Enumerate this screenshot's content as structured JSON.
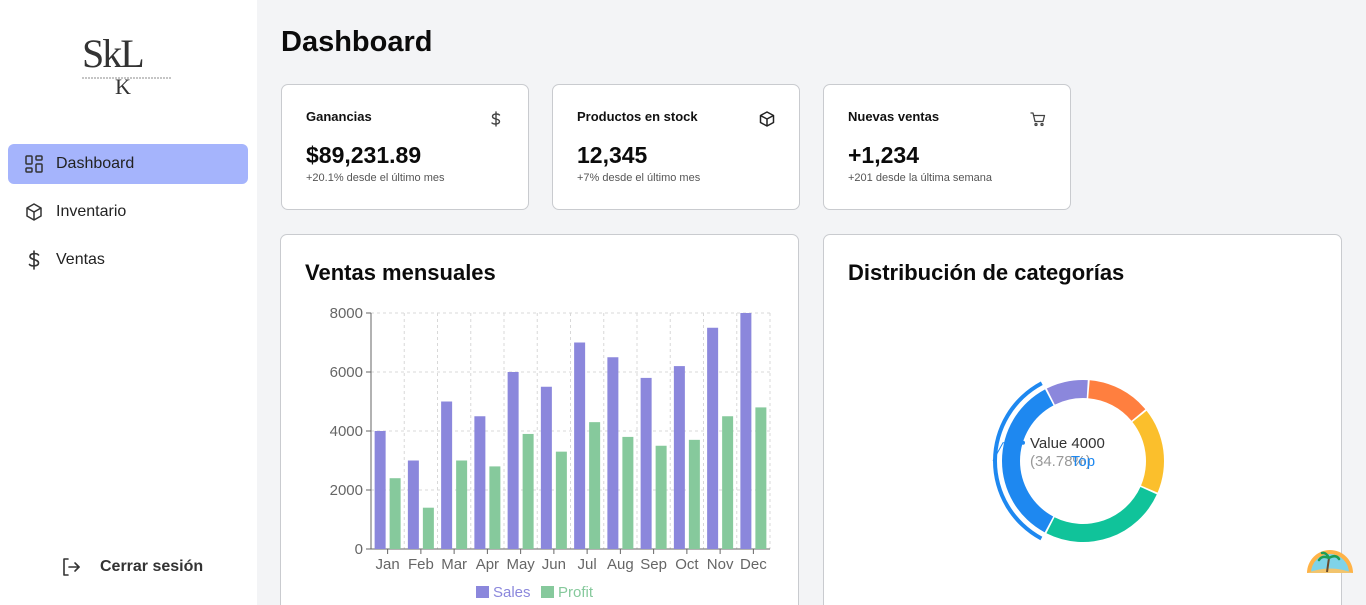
{
  "sidebar": {
    "logo_text": "SkL",
    "items": [
      {
        "label": "Dashboard",
        "icon": "dashboard-icon",
        "active": true
      },
      {
        "label": "Inventario",
        "icon": "box-icon",
        "active": false
      },
      {
        "label": "Ventas",
        "icon": "dollar-icon",
        "active": false
      }
    ],
    "logout_label": "Cerrar sesión"
  },
  "header": {
    "title": "Dashboard"
  },
  "stats": [
    {
      "label": "Ganancias",
      "value": "$89,231.89",
      "sub": "+20.1% desde el último mes",
      "icon": "dollar-icon"
    },
    {
      "label": "Productos en stock",
      "value": "12,345",
      "sub": "+7% desde el último mes",
      "icon": "box-icon"
    },
    {
      "label": "Nuevas ventas",
      "value": "+1,234",
      "sub": "+201 desde la última semana",
      "icon": "cart-icon"
    }
  ],
  "colors": {
    "accent": "#a5b4fc",
    "sales": "#8b87dc",
    "profit": "#86c99c"
  },
  "bar_panel": {
    "title": "Ventas mensuales"
  },
  "pie_panel": {
    "title": "Distribución de categorías",
    "center_label": "Top",
    "tooltip_value": "Value 4000",
    "tooltip_percent": "(34.78%)"
  },
  "chart_data": [
    {
      "type": "bar",
      "categories": [
        "Jan",
        "Feb",
        "Mar",
        "Apr",
        "May",
        "Jun",
        "Jul",
        "Aug",
        "Sep",
        "Oct",
        "Nov",
        "Dec"
      ],
      "series": [
        {
          "name": "Sales",
          "values": [
            4000,
            3000,
            5000,
            4500,
            6000,
            5500,
            7000,
            6500,
            5800,
            6200,
            7500,
            8000
          ],
          "color": "#8b87dc"
        },
        {
          "name": "Profit",
          "values": [
            2400,
            1400,
            3000,
            2800,
            3900,
            3300,
            4300,
            3800,
            3500,
            3700,
            4500,
            4800
          ],
          "color": "#86c99c"
        }
      ],
      "yticks": [
        0,
        2000,
        4000,
        6000,
        8000
      ],
      "ylim": [
        0,
        8000
      ],
      "grid": true,
      "legend": "bottom"
    },
    {
      "type": "pie",
      "values": [
        4000,
        1000,
        1500,
        2000,
        3000
      ],
      "colors": [
        "#1e88f0",
        "#8b87dc",
        "#ff7f3f",
        "#fbbf2c",
        "#10c39a"
      ],
      "highlighted": 0
    }
  ]
}
